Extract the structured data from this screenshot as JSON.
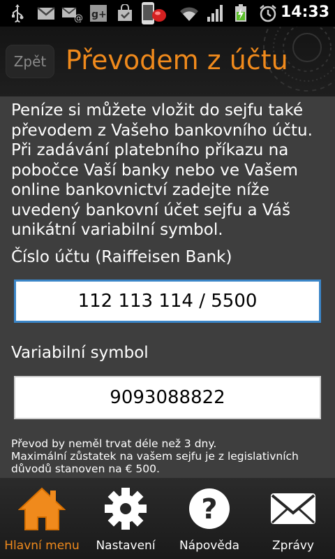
{
  "status_bar": {
    "time": "14:33",
    "icons": [
      "usb-icon",
      "gmail-icon",
      "email-icon",
      "google-plus-icon",
      "bag-icon",
      "phone-icon",
      "wifi-icon",
      "signal-icon",
      "battery-icon",
      "alarm-icon"
    ]
  },
  "header": {
    "back_label": "Zpět",
    "title": "Převodem z účtu"
  },
  "content": {
    "intro": "Peníze si můžete vložit do sejfu také převodem z Vašeho bankovního účtu. Při zadávání platebního příkazu na pobočce Vaší banky nebo ve Vašem online bankovnictví zadejte níže uvedený bankovní účet sejfu a Váš unikátní variabilní symbol.",
    "account_label": "Číslo účtu (Raiffeisen Bank)",
    "account_value": "112 113 114 / 5500",
    "vs_label": "Variabilní symbol",
    "vs_value": "9093088822",
    "note_line1": "Převod by neměl trvat déle než 3 dny.",
    "note_line2": "Maximální zůstatek na vašem sejfu je z legislativních důvodů stanoven na € 500."
  },
  "bottom_nav": {
    "items": [
      {
        "label": "Hlavní menu",
        "icon": "home-icon",
        "active": true
      },
      {
        "label": "Nastavení",
        "icon": "gear-icon",
        "active": false
      },
      {
        "label": "Nápověda",
        "icon": "help-icon",
        "active": false
      },
      {
        "label": "Zprávy",
        "icon": "envelope-icon",
        "active": false
      }
    ]
  },
  "colors": {
    "accent": "#f08a1c",
    "background": "#3e3e3e",
    "focus": "#3b86c8"
  }
}
